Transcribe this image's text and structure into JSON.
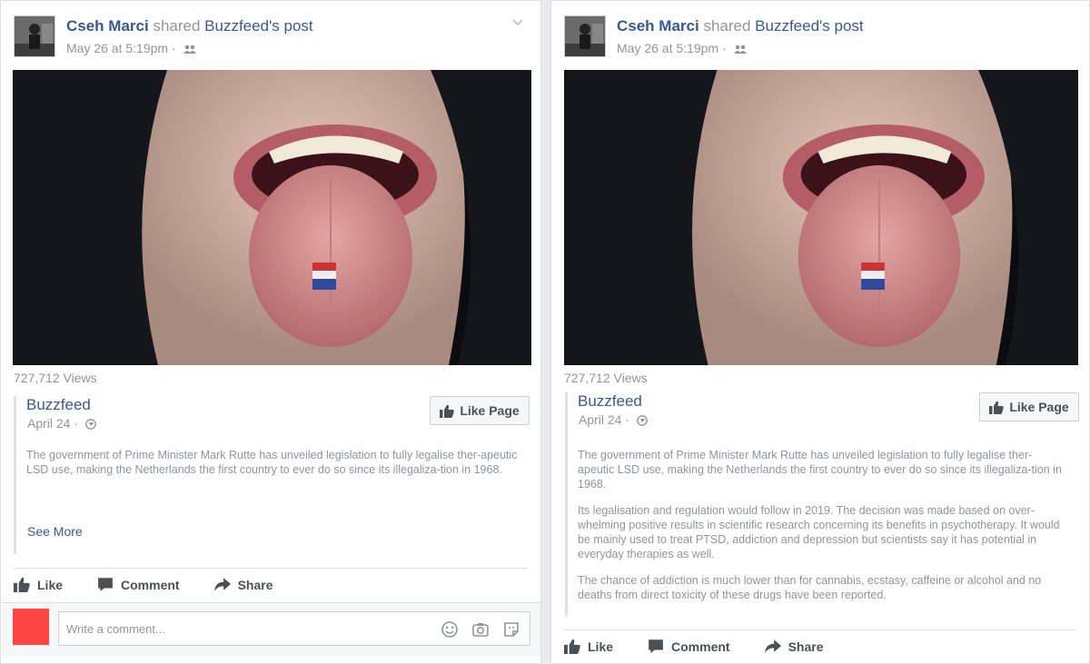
{
  "posts": [
    {
      "author": "Cseh Marci",
      "verb": "shared",
      "page": "Buzzfeed",
      "possessive": "'s post",
      "timestamp": "May 26 at 5:19pm",
      "views": "727,712 Views",
      "source_name": "Buzzfeed",
      "source_date": "April 24 ·",
      "like_page": "Like Page",
      "paragraphs": [
        "The government of Prime Minister Mark Rutte has unveiled legislation to fully legalise ther-apeutic LSD use, making the Netherlands the first country to ever do so since its illegaliza-tion in 1968."
      ],
      "see_more": "See More",
      "actions": {
        "like": "Like",
        "comment": "Comment",
        "share": "Share"
      },
      "comment_placeholder": "Write a comment..."
    },
    {
      "author": "Cseh Marci",
      "verb": "shared",
      "page": "Buzzfeed",
      "possessive": "'s post",
      "timestamp": "May 26 at 5:19pm",
      "views": "727,712 Views",
      "source_name": "Buzzfeed",
      "source_date": "April 24 ·",
      "like_page": "Like Page",
      "paragraphs": [
        "The government of Prime Minister Mark Rutte has unveiled legislation to fully legalise ther-apeutic LSD use, making the Netherlands the first country to ever do so since its illegaliza-tion in 1968.",
        "Its legalisation and regulation would follow in 2019. The decision was made based on over-whelming positive results in scientific research concerning its benefits in psychotherapy. It would be mainly used to treat PTSD, addiction and depression but scientists say it has potential in everyday therapies as well.",
        "The chance of addiction is much lower than for cannabis, ecstasy, caffeine or alcohol and no deaths from direct toxicity of these drugs have been reported."
      ],
      "actions": {
        "like": "Like",
        "comment": "Comment",
        "share": "Share"
      }
    }
  ],
  "colors": {
    "link": "#365899",
    "muted": "#90949c",
    "border": "#dddfe2"
  },
  "icons": [
    "friends-icon",
    "chevron-down-icon",
    "globe-icon",
    "thumbs-up-icon",
    "comment-icon",
    "share-icon",
    "emoji-icon",
    "camera-icon",
    "sticker-icon"
  ]
}
